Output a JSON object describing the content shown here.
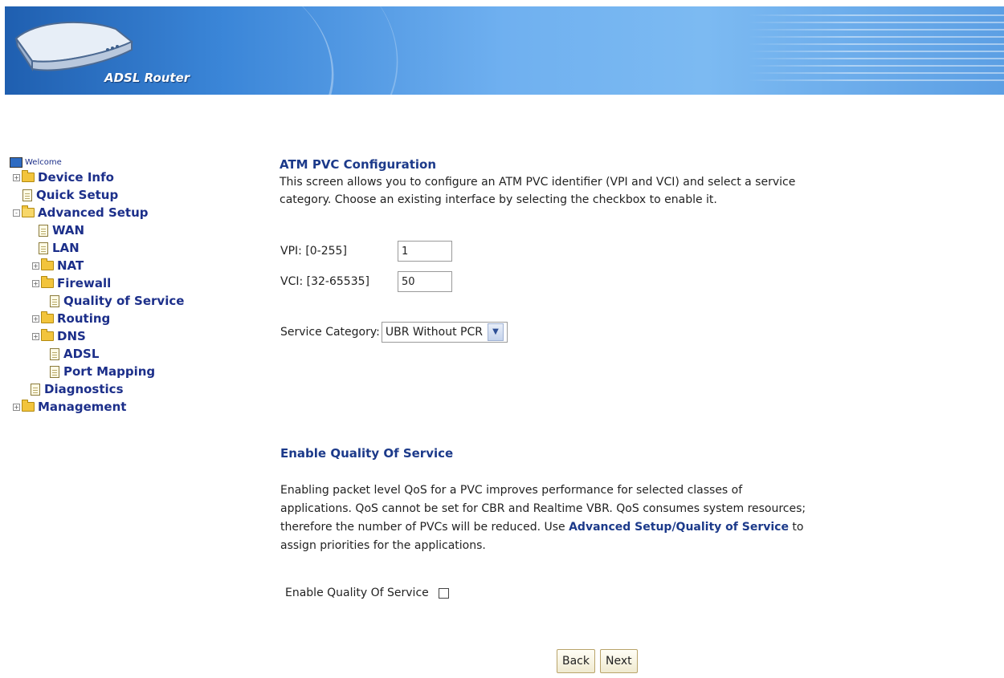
{
  "header": {
    "brand": "ADSL Router",
    "colors": {
      "banner_dark": "#1f5fb0",
      "banner_light": "#7cbaf2"
    }
  },
  "sidebar": {
    "welcome": "Welcome",
    "items": [
      {
        "label": "Device Info",
        "type": "folder",
        "expander": "+"
      },
      {
        "label": "Quick Setup",
        "type": "page"
      },
      {
        "label": "Advanced Setup",
        "type": "folder",
        "expander": "-",
        "open": true
      },
      {
        "label": "WAN",
        "type": "page"
      },
      {
        "label": "LAN",
        "type": "page"
      },
      {
        "label": "NAT",
        "type": "folder",
        "expander": "+"
      },
      {
        "label": "Firewall",
        "type": "folder",
        "expander": "+"
      },
      {
        "label": "Quality of Service",
        "type": "page"
      },
      {
        "label": "Routing",
        "type": "folder",
        "expander": "+"
      },
      {
        "label": "DNS",
        "type": "folder",
        "expander": "+"
      },
      {
        "label": "ADSL",
        "type": "page"
      },
      {
        "label": "Port Mapping",
        "type": "page"
      },
      {
        "label": "Diagnostics",
        "type": "page"
      },
      {
        "label": "Management",
        "type": "folder",
        "expander": "+"
      }
    ]
  },
  "atm": {
    "title": "ATM PVC Configuration",
    "description_line1": "This screen allows you to configure an ATM PVC identifier (VPI and VCI) and select a service",
    "description_line2": "category. Choose an existing interface by selecting the checkbox to enable it.",
    "vpi_label": "VPI: [0-255]",
    "vpi_value": "1",
    "vci_label": "VCI: [32-65535]",
    "vci_value": "50",
    "service_label": "Service Category:",
    "service_value": "UBR Without PCR"
  },
  "qos": {
    "title": "Enable Quality Of Service",
    "para_line1": "Enabling packet level QoS for a PVC improves performance for selected classes of",
    "para_line2": "applications.  QoS cannot be set for CBR and Realtime VBR.  QoS consumes system resources;",
    "para_line3_pre": "therefore the number of PVCs will be reduced. Use",
    "para_line3_link": "Advanced Setup/Quality of Service",
    "para_line3_post": "to",
    "para_line4": "assign priorities for the applications.",
    "checkbox_label": "Enable Quality Of Service",
    "checkbox_checked": false
  },
  "buttons": {
    "back": "Back",
    "next": "Next"
  }
}
